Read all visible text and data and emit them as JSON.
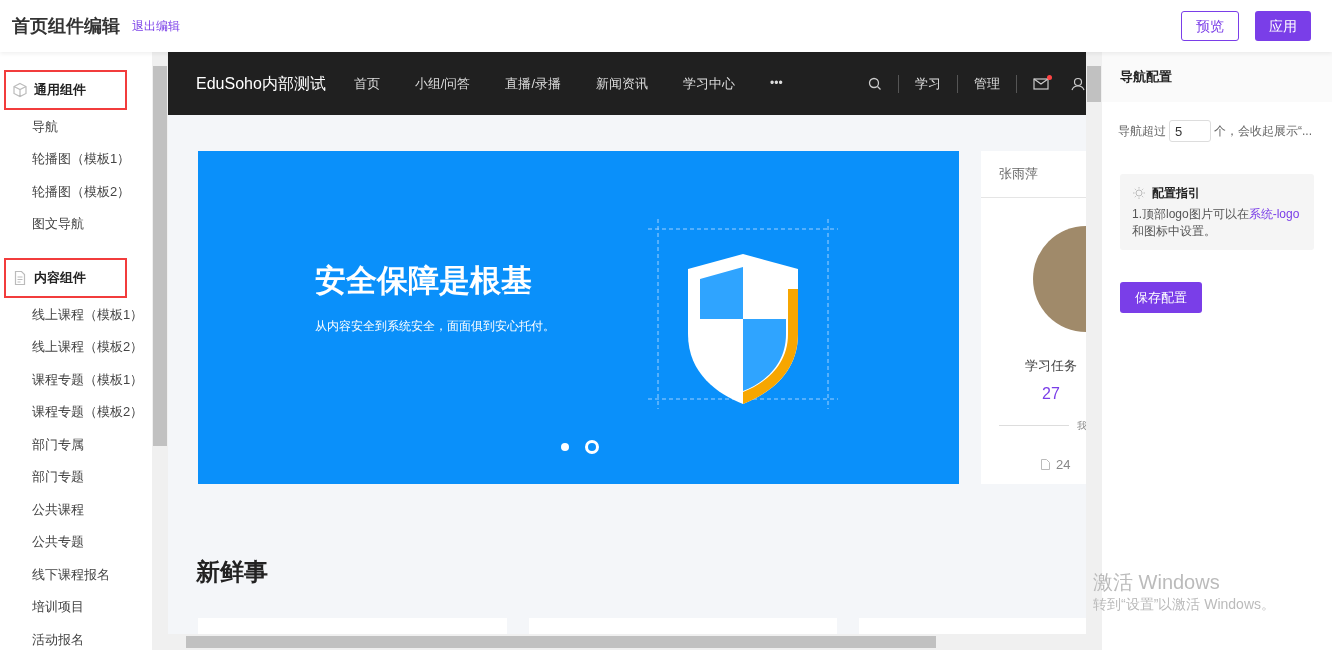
{
  "header": {
    "title": "首页组件编辑",
    "exit_link": "退出编辑",
    "buttons": [
      {
        "label": "预览",
        "kind": "outline"
      },
      {
        "label": "应用",
        "kind": "primary"
      }
    ]
  },
  "sidebar": {
    "groups": [
      {
        "title": "通用组件",
        "highlighted": true,
        "items": [
          "导航",
          "轮播图（模板1）",
          "轮播图（模板2）",
          "图文导航"
        ]
      },
      {
        "title": "内容组件",
        "highlighted": true,
        "items": [
          "线上课程（模板1）",
          "线上课程（模板2）",
          "课程专题（模板1）",
          "课程专题（模板2）",
          "部门专属",
          "部门专题",
          "公共课程",
          "公共专题",
          "线下课程报名",
          "培训项目",
          "活动报名"
        ]
      }
    ]
  },
  "preview": {
    "navbar": {
      "brand": "EduSoho内部测试",
      "links": [
        "首页",
        "小组/问答",
        "直播/录播",
        "新闻资讯",
        "学习中心"
      ],
      "more": "•••",
      "right_links": [
        "学习",
        "管理"
      ],
      "has_unread": true
    },
    "banner": {
      "title": "安全保障是根基",
      "subtitle": "从内容安全到系统安全，面面俱到安心托付。",
      "dots": [
        {
          "selected": false
        },
        {
          "selected": true
        }
      ]
    },
    "profile_card": {
      "name": "张雨萍",
      "stat_label": "学习任务",
      "stat_value": "27",
      "divider_text": "我",
      "footer_count": "24"
    },
    "section_title": "新鲜事"
  },
  "panel": {
    "title": "导航配置",
    "setting": {
      "prefix": "导航超过",
      "value": "5",
      "suffix": "个，会收起展示“..."
    },
    "guide": {
      "title": "配置指引",
      "text_before": "1.顶部logo图片可以在",
      "link": "系统-logo",
      "text_after": "和图标中设置。"
    },
    "save_button": "保存配置"
  },
  "os_notice": {
    "title": "激活 Windows",
    "text": "转到“设置”以激活 Windows。"
  }
}
